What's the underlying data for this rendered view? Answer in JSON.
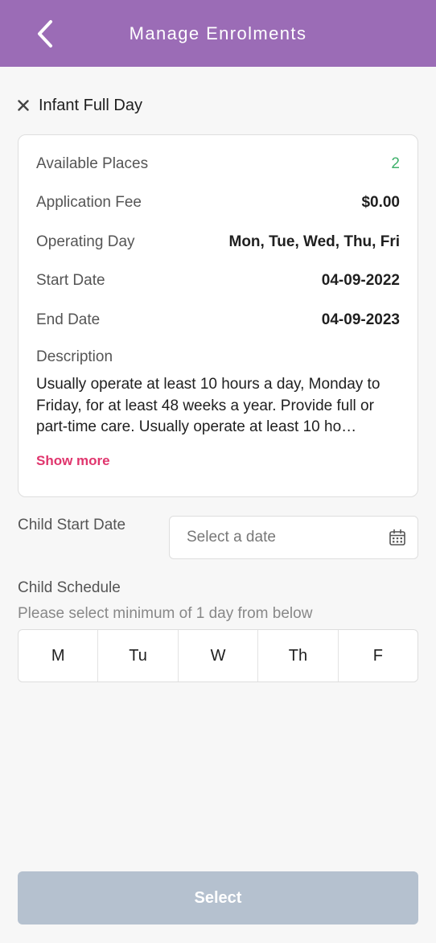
{
  "header": {
    "title": "Manage Enrolments",
    "back_icon": "chevron-left-icon"
  },
  "course": {
    "close_icon": "close-icon",
    "title": "Infant Full Day"
  },
  "details": {
    "available_places_label": "Available Places",
    "available_places_value": "2",
    "application_fee_label": "Application Fee",
    "application_fee_value": "$0.00",
    "operating_day_label": "Operating Day",
    "operating_day_value": "Mon, Tue, Wed, Thu, Fri",
    "start_date_label": "Start Date",
    "start_date_value": "04-09-2022",
    "end_date_label": "End Date",
    "end_date_value": "04-09-2023",
    "description_label": "Description",
    "description_text": "Usually operate at least 10 hours a day, Monday to Friday, for at least 48 weeks a year. Provide full or part-time care. Usually operate at least 10 ho…",
    "show_more": "Show more"
  },
  "child_start_date": {
    "label": "Child Start Date",
    "placeholder": "Select a date",
    "icon": "calendar-icon"
  },
  "child_schedule": {
    "label": "Child Schedule",
    "hint": "Please select minimum of 1 day from below",
    "days": [
      "M",
      "Tu",
      "W",
      "Th",
      "F"
    ]
  },
  "select_button": "Select",
  "colors": {
    "header": "#9b6cb6",
    "available_green": "#3fb16b",
    "show_more_pink": "#e0356d",
    "select_disabled": "#b5c1cf"
  }
}
